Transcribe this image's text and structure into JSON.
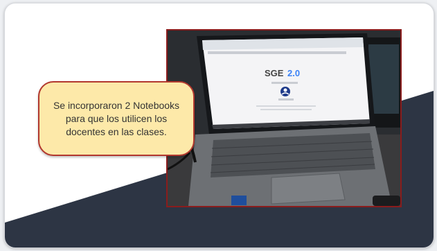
{
  "callout": {
    "text": "Se incorporaron 2 Notebooks para que los utilicen los docentes en las clases."
  },
  "photo": {
    "screen": {
      "app_title": "SGE",
      "app_version": "2.0"
    }
  },
  "colors": {
    "navy": "#2d3544",
    "callout_fill": "#fde9a9",
    "callout_border": "#b2382e",
    "photo_frame": "#8a1c1c",
    "accent_blue": "#3b82f6"
  },
  "icons": [
    "user-avatar-icon"
  ]
}
